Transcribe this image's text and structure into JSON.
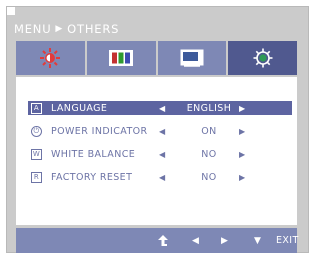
{
  "breadcrumb": {
    "parent": "MENU",
    "current": "OTHERS"
  },
  "tabs": [
    {
      "name": "brightness-icon"
    },
    {
      "name": "color-icon"
    },
    {
      "name": "position-icon"
    },
    {
      "name": "settings-icon",
      "active": true
    }
  ],
  "menu": {
    "items": [
      {
        "icon_glyph": "A",
        "label": "LANGUAGE",
        "value": "ENGLISH",
        "selected": true
      },
      {
        "icon_glyph": "⏻",
        "label": "POWER INDICATOR",
        "value": "ON"
      },
      {
        "icon_glyph": "W",
        "label": "WHITE BALANCE",
        "value": "NO"
      },
      {
        "icon_glyph": "R",
        "label": "FACTORY RESET",
        "value": "NO"
      }
    ]
  },
  "footer": {
    "exit_label": "EXIT"
  },
  "colors": {
    "tab": "#7e88b5",
    "tab_active": "#50598f",
    "row_selected": "#5d64a1",
    "text": "#6d74a6"
  }
}
